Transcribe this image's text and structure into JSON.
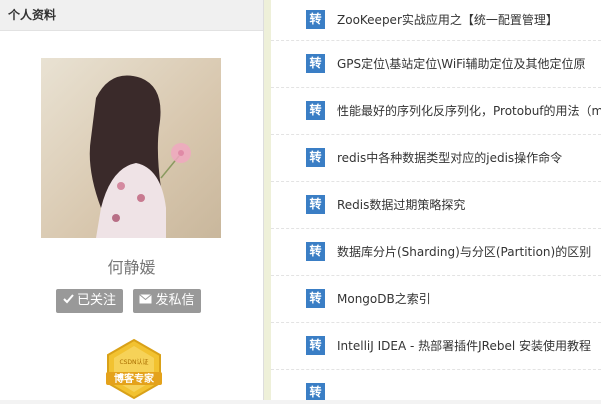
{
  "sidebar": {
    "header": "个人资料",
    "name": "何静媛",
    "follow_label": "已关注",
    "message_label": "发私信",
    "badge_text": "博客专家",
    "badge_subtext": "CSDN认证"
  },
  "articles": [
    {
      "tag": "转",
      "title": "ZooKeeper实战应用之【统一配置管理】"
    },
    {
      "tag": "转",
      "title": "GPS定位\\基站定位\\WiFi辅助定位及其他定位原"
    },
    {
      "tag": "转",
      "title": "性能最好的序列化反序列化，Protobuf的用法（m"
    },
    {
      "tag": "转",
      "title": "redis中各种数据类型对应的jedis操作命令"
    },
    {
      "tag": "转",
      "title": "Redis数据过期策略探究"
    },
    {
      "tag": "转",
      "title": "数据库分片(Sharding)与分区(Partition)的区别"
    },
    {
      "tag": "转",
      "title": "MongoDB之索引"
    },
    {
      "tag": "转",
      "title": "IntelliJ IDEA - 热部署插件JRebel 安装使用教程"
    },
    {
      "tag": "转",
      "title": ""
    }
  ],
  "colors": {
    "tag_bg": "#3a7ec5",
    "button_bg": "#999999",
    "gutter": "#eef0d9"
  }
}
